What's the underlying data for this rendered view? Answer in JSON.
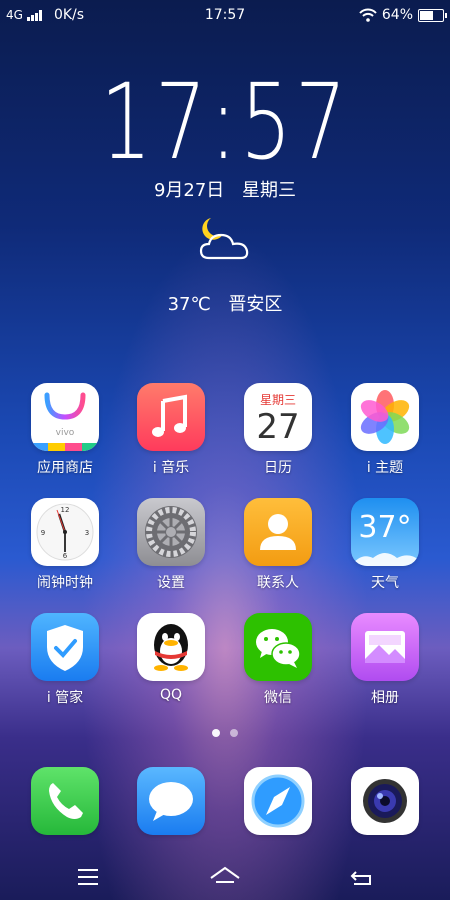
{
  "status_bar": {
    "network": "4G",
    "speed": "0K/s",
    "time": "17:57",
    "battery_percent": "64%",
    "battery_level": 0.64,
    "icons": [
      "signal-icon",
      "wifi-icon",
      "battery-icon"
    ]
  },
  "clock_widget": {
    "time": "17:57",
    "date": "9月27日",
    "weekday": "星期三",
    "weather_icon": "moon-cloud-icon",
    "temperature": "37℃",
    "location": "晋安区"
  },
  "apps": [
    {
      "label": "应用商店",
      "icon": "app-store-icon",
      "color": "#ffffff"
    },
    {
      "label": "i 音乐",
      "icon": "music-icon",
      "color": "#ff5a5f"
    },
    {
      "label": "日历",
      "icon": "calendar-icon",
      "color": "#ffffff",
      "calendar_weekday": "星期三",
      "calendar_day": "27"
    },
    {
      "label": "i 主题",
      "icon": "theme-icon",
      "color": "#ffffff"
    },
    {
      "label": "闹钟时钟",
      "icon": "clock-icon",
      "color": "#ffffff"
    },
    {
      "label": "设置",
      "icon": "settings-icon",
      "color": "#8e8e93"
    },
    {
      "label": "联系人",
      "icon": "contacts-icon",
      "color": "#f5a623"
    },
    {
      "label": "天气",
      "icon": "weather-icon",
      "color": "#3aa7f5",
      "weather_value": "37°"
    },
    {
      "label": "i 管家",
      "icon": "manager-icon",
      "color": "#2f9cff"
    },
    {
      "label": "QQ",
      "icon": "qq-icon",
      "color": "#ffffff"
    },
    {
      "label": "微信",
      "icon": "wechat-icon",
      "color": "#2dc100"
    },
    {
      "label": "相册",
      "icon": "gallery-icon",
      "color": "#c86cf0"
    }
  ],
  "page_indicator": {
    "pages": 2,
    "current": 1
  },
  "dock": [
    {
      "icon": "phone-icon",
      "color": "#3ccf4e"
    },
    {
      "icon": "messages-icon",
      "color": "#2f9cff"
    },
    {
      "icon": "browser-icon",
      "color": "#ffffff"
    },
    {
      "icon": "camera-icon",
      "color": "#ffffff"
    }
  ],
  "nav_bar": [
    "menu-icon",
    "home-icon",
    "back-icon"
  ]
}
